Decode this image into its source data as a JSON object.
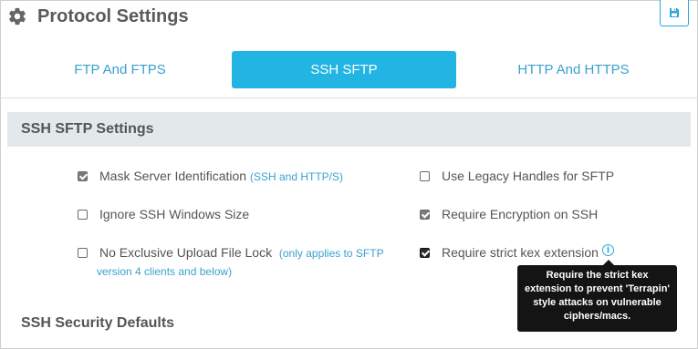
{
  "header": {
    "title": "Protocol Settings"
  },
  "tabs": [
    {
      "label": "FTP And FTPS"
    },
    {
      "label": "SSH SFTP"
    },
    {
      "label": "HTTP And HTTPS"
    }
  ],
  "section": {
    "title": "SSH SFTP Settings",
    "options": {
      "mask_server": {
        "label": "Mask Server Identification",
        "note": "(SSH and HTTP/S)",
        "checked": true
      },
      "legacy_handles": {
        "label": "Use Legacy Handles for SFTP",
        "checked": false
      },
      "ignore_window": {
        "label": "Ignore SSH Windows Size",
        "checked": false
      },
      "require_encryption": {
        "label": "Require Encryption on SSH",
        "checked": true
      },
      "no_exclusive_lock": {
        "label": "No Exclusive Upload File Lock",
        "note_line1": "(only applies to SFTP",
        "note_line2": "version 4 clients and below)",
        "checked": false
      },
      "strict_kex": {
        "label": "Require strict kex extension",
        "checked": true
      }
    }
  },
  "tooltip": {
    "text_line1": "Require the strict kex",
    "text_line2": "extension to prevent 'Terrapin'",
    "text_line3": "style attacks on vulnerable",
    "text_line4": "ciphers/macs."
  },
  "section2": {
    "title": "SSH Security Defaults"
  },
  "icons": {
    "gear": "gear-icon",
    "save": "floppy-disk-icon",
    "info": "info-icon"
  },
  "colors": {
    "accent": "#22b5e3",
    "link": "#3aa0d0",
    "section_bg": "#e3e9ea",
    "tooltip_bg": "#141414"
  }
}
